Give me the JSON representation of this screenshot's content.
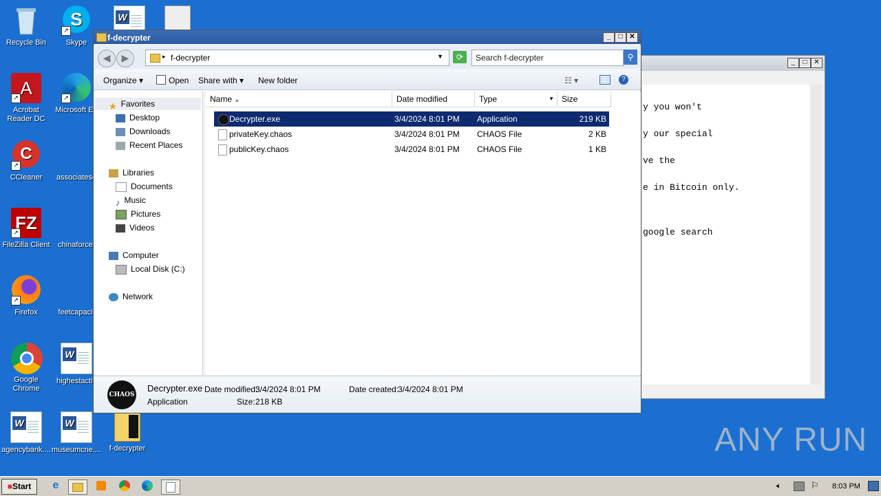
{
  "desktop": {
    "icons": [
      {
        "label": "Recycle Bin",
        "icon": "recycle-bin-icon"
      },
      {
        "label": "Skype",
        "icon": "skype-icon"
      },
      {
        "label": "Acrobat\nReader DC",
        "icon": "acrobat-icon"
      },
      {
        "label": "Microsoft Ed",
        "icon": "edge-icon"
      },
      {
        "label": "CCleaner",
        "icon": "ccleaner-icon"
      },
      {
        "label": "associatese",
        "icon": "document-icon"
      },
      {
        "label": "FileZilla Client",
        "icon": "filezilla-icon"
      },
      {
        "label": "chinaforce.",
        "icon": "document-icon"
      },
      {
        "label": "Firefox",
        "icon": "firefox-icon"
      },
      {
        "label": "feetcapacit",
        "icon": "document-icon"
      },
      {
        "label": "Google\nChrome",
        "icon": "chrome-icon"
      },
      {
        "label": "highestactiv",
        "icon": "word-doc-icon"
      },
      {
        "label": "agencybank....",
        "icon": "word-doc-icon"
      },
      {
        "label": "museumcne....",
        "icon": "word-doc-icon"
      },
      {
        "label": "f-decrypter",
        "icon": "folder-icon"
      }
    ]
  },
  "notepad": {
    "text_lines": [
      "y you won't",
      "y our special",
      "ve the",
      "e in Bitcoin only.",
      "",
      "google search"
    ]
  },
  "explorer": {
    "title": "f-decrypter",
    "address": "f-decrypter",
    "search_placeholder": "Search f-decrypter",
    "toolbar": {
      "organize": "Organize",
      "open": "Open",
      "share_with": "Share with",
      "new_folder": "New folder"
    },
    "nav": {
      "favorites": "Favorites",
      "desktop": "Desktop",
      "downloads": "Downloads",
      "recent_places": "Recent Places",
      "libraries": "Libraries",
      "documents": "Documents",
      "music": "Music",
      "pictures": "Pictures",
      "videos": "Videos",
      "computer": "Computer",
      "local_disk": "Local Disk (C:)",
      "network": "Network"
    },
    "columns": {
      "name": "Name",
      "date_modified": "Date modified",
      "type": "Type",
      "size": "Size"
    },
    "files": [
      {
        "name": "Decrypter.exe",
        "date": "3/4/2024 8:01 PM",
        "type": "Application",
        "size": "219 KB"
      },
      {
        "name": "privateKey.chaos",
        "date": "3/4/2024 8:01 PM",
        "type": "CHAOS File",
        "size": "2 KB"
      },
      {
        "name": "publicKey.chaos",
        "date": "3/4/2024 8:01 PM",
        "type": "CHAOS File",
        "size": "1 KB"
      }
    ],
    "details": {
      "filename": "Decrypter.exe",
      "filetype": "Application",
      "date_modified_label": "Date modified:",
      "date_modified": "3/4/2024 8:01 PM",
      "size_label": "Size:",
      "size": "218 KB",
      "date_created_label": "Date created:",
      "date_created": "3/4/2024 8:01 PM",
      "logo_text": "CHAOS"
    }
  },
  "taskbar": {
    "start": "Start",
    "clock": "8:03 PM"
  },
  "watermark": "ANY RUN",
  "colors": {
    "desktop": "#1a6fd1",
    "selection": "#0e2a70",
    "titlebar": "#2d5aa0"
  }
}
